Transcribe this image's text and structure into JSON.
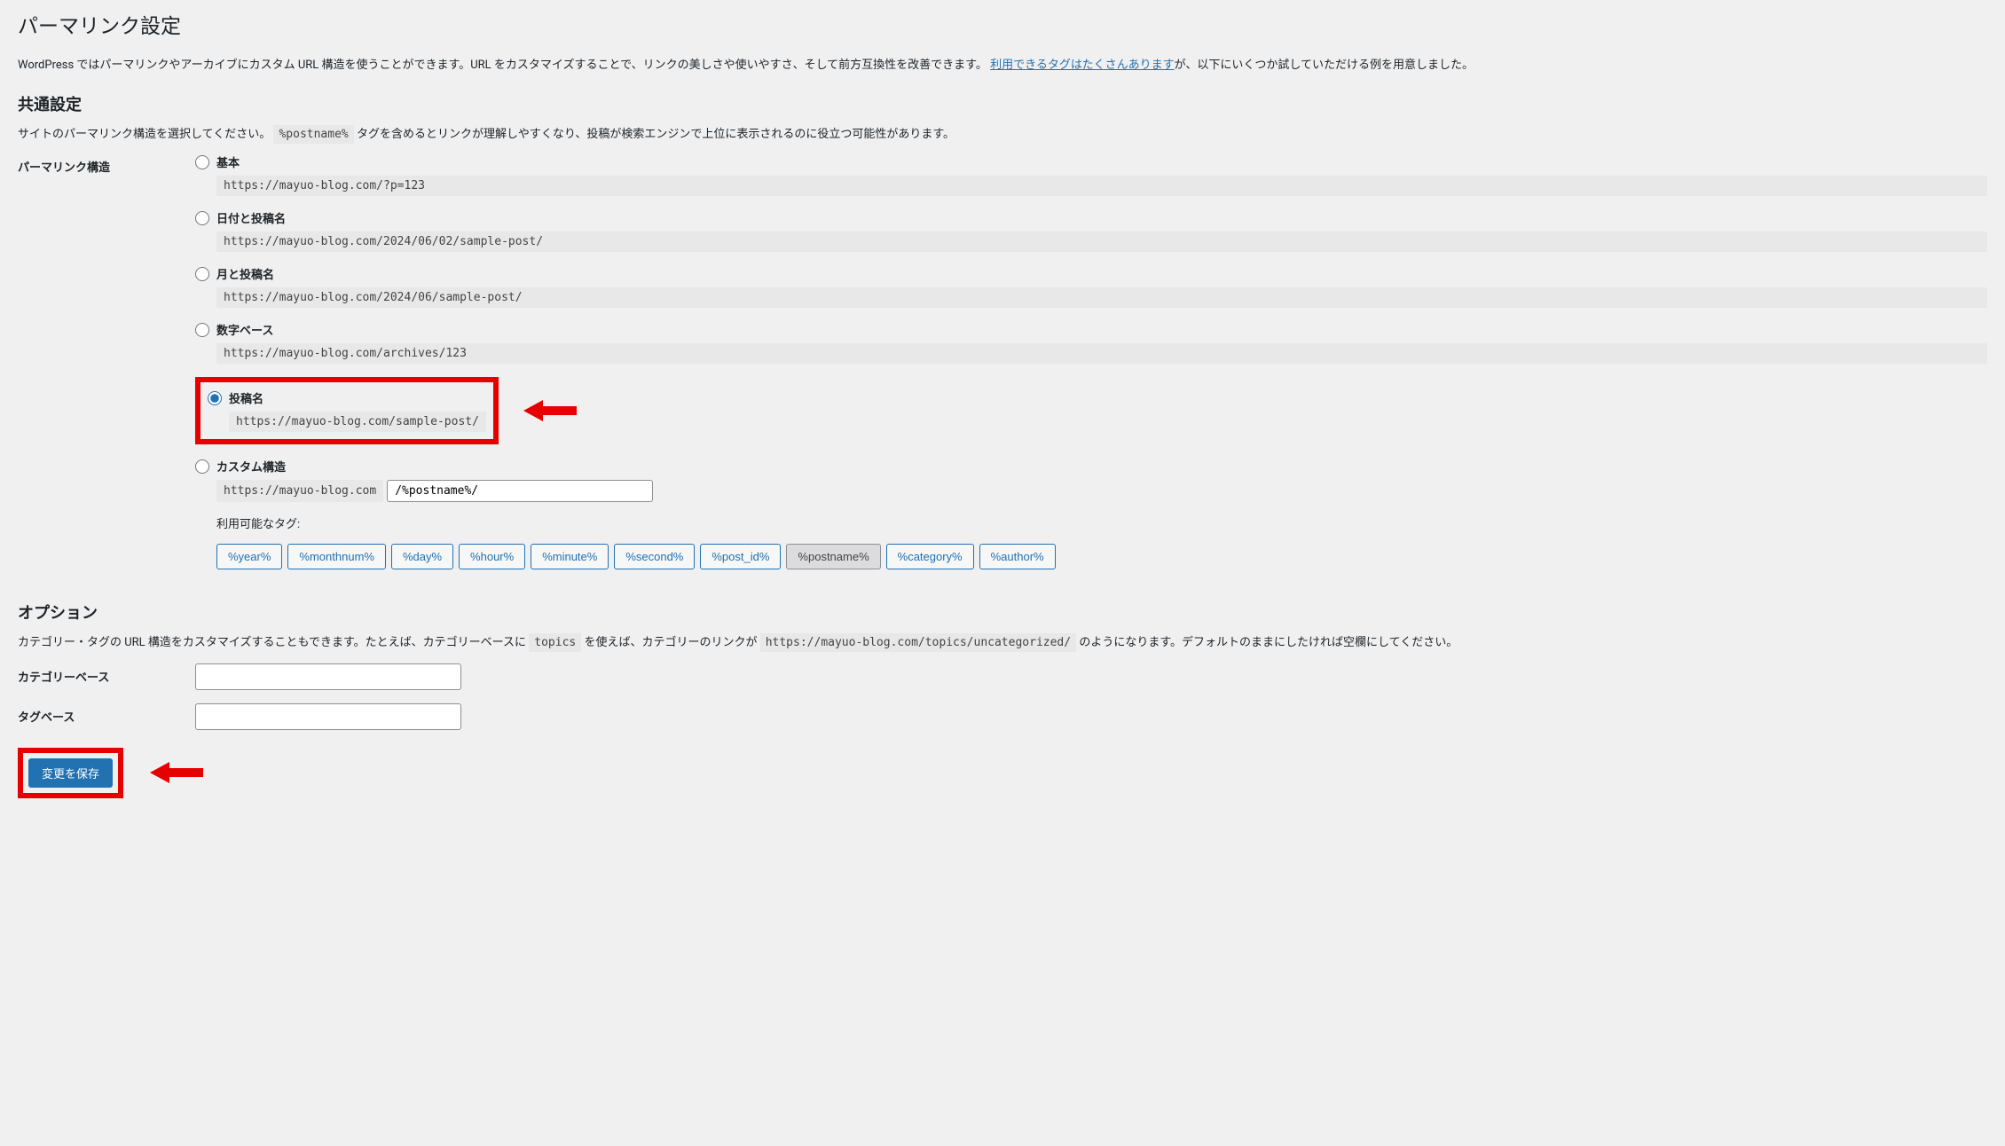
{
  "page_title": "パーマリンク設定",
  "intro_text_1": "WordPress ではパーマリンクやアーカイブにカスタム URL 構造を使うことができます。URL をカスタマイズすることで、リンクの美しさや使いやすさ、そして前方互換性を改善できます。",
  "intro_link": "利用できるタグはたくさんあります",
  "intro_text_2": "が、以下にいくつか試していただける例を用意しました。",
  "section_common": "共通設定",
  "common_desc_1": "サイトのパーマリンク構造を選択してください。",
  "common_desc_code": "%postname%",
  "common_desc_2": "タグを含めるとリンクが理解しやすくなり、投稿が検索エンジンで上位に表示されるのに役立つ可能性があります。",
  "permalink_label": "パーマリンク構造",
  "options": {
    "basic": {
      "label": "基本",
      "url": "https://mayuo-blog.com/?p=123"
    },
    "date_name": {
      "label": "日付と投稿名",
      "url": "https://mayuo-blog.com/2024/06/02/sample-post/"
    },
    "month_name": {
      "label": "月と投稿名",
      "url": "https://mayuo-blog.com/2024/06/sample-post/"
    },
    "numeric": {
      "label": "数字ベース",
      "url": "https://mayuo-blog.com/archives/123"
    },
    "postname": {
      "label": "投稿名",
      "url": "https://mayuo-blog.com/sample-post/"
    },
    "custom": {
      "label": "カスタム構造",
      "prefix": "https://mayuo-blog.com",
      "value": "/%postname%/"
    }
  },
  "available_tags_label": "利用可能なタグ:",
  "tags": [
    "%year%",
    "%monthnum%",
    "%day%",
    "%hour%",
    "%minute%",
    "%second%",
    "%post_id%",
    "%postname%",
    "%category%",
    "%author%"
  ],
  "active_tag": "%postname%",
  "section_options": "オプション",
  "options_desc_1": "カテゴリー・タグの URL 構造をカスタマイズすることもできます。たとえば、カテゴリーベースに ",
  "options_desc_code1": "topics",
  "options_desc_2": " を使えば、カテゴリーのリンクが ",
  "options_desc_code2": "https://mayuo-blog.com/topics/uncategorized/",
  "options_desc_3": " のようになります。デフォルトのままにしたければ空欄にしてください。",
  "category_base_label": "カテゴリーベース",
  "tag_base_label": "タグベース",
  "save_button": "変更を保存"
}
